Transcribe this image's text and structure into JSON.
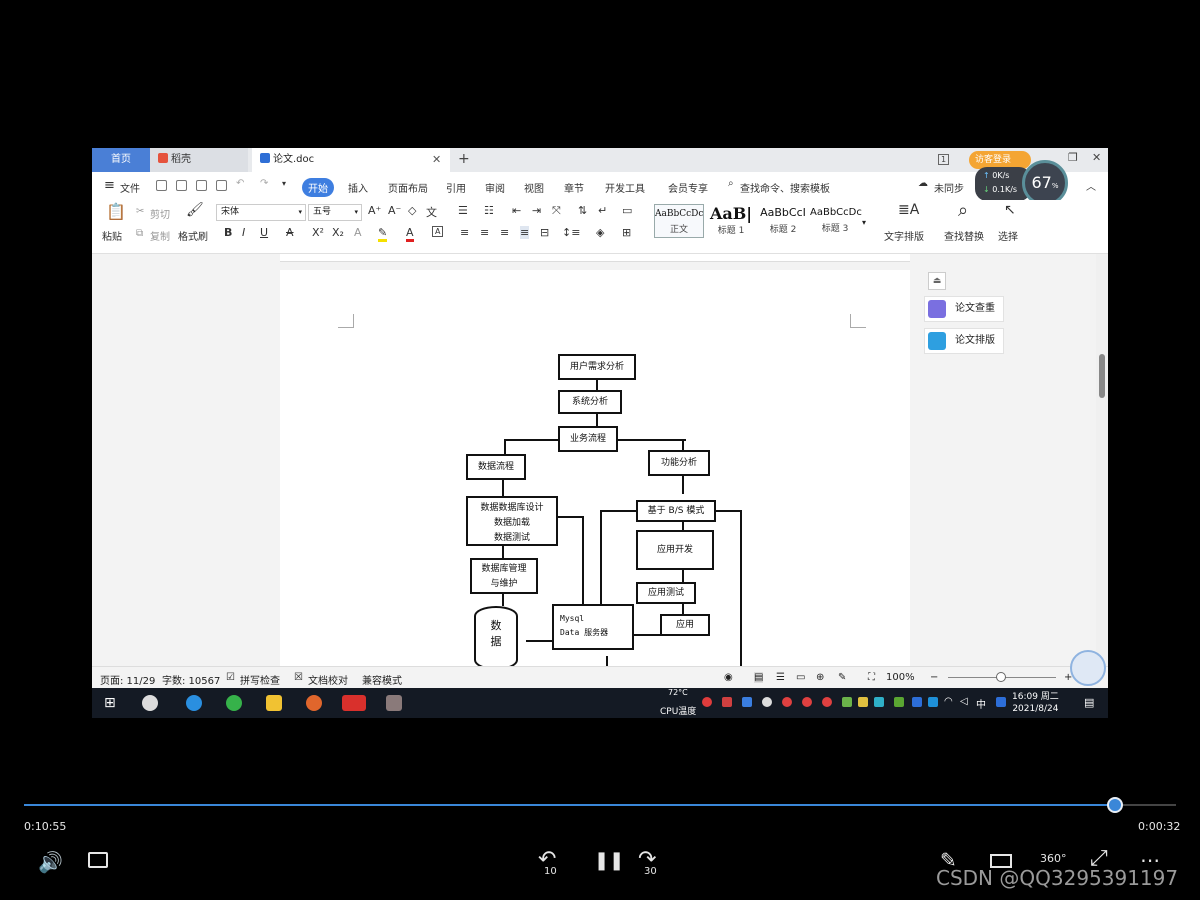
{
  "window": {
    "tabs": [
      {
        "label": "首页"
      },
      {
        "label": "稻壳"
      },
      {
        "label": "论文.doc"
      }
    ],
    "visitor_login": "访客登录",
    "net_up": "0K/s",
    "net_down": "0.1K/s",
    "gauge": {
      "value": "67",
      "unit": "%"
    }
  },
  "menu": {
    "file": "文件",
    "items": [
      "开始",
      "插入",
      "页面布局",
      "引用",
      "审阅",
      "视图",
      "章节",
      "开发工具",
      "会员专享"
    ],
    "search_placeholder": "查找命令、搜索模板",
    "sync": "未同步"
  },
  "ribbon": {
    "paste": "粘贴",
    "cut": "剪切",
    "copy": "复制",
    "format_painter": "格式刷",
    "font_name": "宋体",
    "font_size": "五号",
    "styles": [
      {
        "preview": "AaBbCcDc",
        "name": "正文"
      },
      {
        "preview": "AaB|",
        "name": "标题 1"
      },
      {
        "preview": "AaBbCcI",
        "name": "标题 2"
      },
      {
        "preview": "AaBbCcDc",
        "name": "标题 3"
      }
    ],
    "text_layout": "文字排版",
    "find_replace": "查找替换",
    "select": "选择"
  },
  "side_panel": {
    "check": "论文查重",
    "layout": "论文排版"
  },
  "flowchart": {
    "nodes": {
      "req": "用户需求分析",
      "sys": "系统分析",
      "biz": "业务流程",
      "data_flow": "数据流程",
      "func": "功能分析",
      "db_design_1": "数据数据库设计",
      "db_design_2": "数据加载",
      "db_design_3": "数据测试",
      "bs": "基于 B/S 模式",
      "dev": "应用开发",
      "db_mgmt_1": "数据库管理",
      "db_mgmt_2": "与维护",
      "test": "应用测试",
      "db_1": "数",
      "db_2": "据",
      "server_1": "Mysql",
      "server_2": "Data 服务器",
      "app": "应用"
    }
  },
  "status": {
    "page": "页面: 11/29",
    "words": "字数: 10567",
    "spell": "拼写检查",
    "proof": "文档校对",
    "compat": "兼容模式",
    "zoom": "100%"
  },
  "taskbar": {
    "temp": "72°C",
    "cpu": "CPU温度",
    "ime": "中",
    "time": "16:09 周二",
    "date": "2021/8/24"
  },
  "player": {
    "elapsed": "0:10:55",
    "remaining": "0:00:32",
    "progress": 0.947,
    "rewind": "10",
    "forward": "30",
    "watermark": "CSDN @QQ3295391197"
  }
}
